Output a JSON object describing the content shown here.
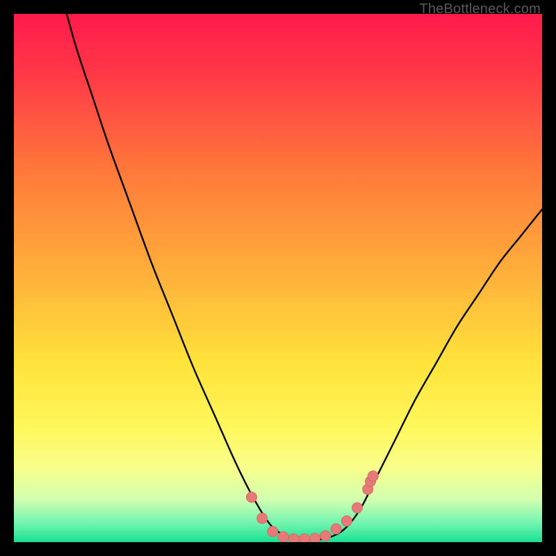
{
  "watermark": "TheBottleneck.com",
  "colors": {
    "frame_bg": "#000000",
    "watermark": "#5a5a5a",
    "curve": "#000000",
    "marker_fill": "#e77a77",
    "marker_stroke": "#d36a67"
  },
  "chart_data": {
    "type": "line",
    "title": "",
    "xlabel": "",
    "ylabel": "",
    "xlim": [
      0,
      100
    ],
    "ylim": [
      0,
      100
    ],
    "gradient_stops": [
      {
        "offset": 0.0,
        "color": "#ff1a4b"
      },
      {
        "offset": 0.12,
        "color": "#ff3a46"
      },
      {
        "offset": 0.3,
        "color": "#ff7a3a"
      },
      {
        "offset": 0.5,
        "color": "#ffb23a"
      },
      {
        "offset": 0.66,
        "color": "#ffe33a"
      },
      {
        "offset": 0.78,
        "color": "#fff75a"
      },
      {
        "offset": 0.86,
        "color": "#f8ff8a"
      },
      {
        "offset": 0.92,
        "color": "#d0ffb0"
      },
      {
        "offset": 0.965,
        "color": "#70f5b0"
      },
      {
        "offset": 1.0,
        "color": "#18e090"
      }
    ],
    "series": [
      {
        "name": "bottleneck-curve",
        "x": [
          10,
          12,
          15,
          18,
          22,
          26,
          30,
          34,
          38,
          42,
          45,
          48,
          50,
          52,
          54,
          56,
          58,
          60,
          62,
          64,
          66,
          68,
          72,
          76,
          80,
          84,
          88,
          92,
          96,
          100
        ],
        "y": [
          100,
          93,
          84,
          75,
          64,
          53,
          43,
          33,
          24,
          15,
          9,
          4,
          2,
          1,
          0.5,
          0.5,
          0.5,
          1,
          2,
          4,
          7,
          11,
          19,
          27,
          34,
          41,
          47,
          53,
          58,
          63
        ]
      }
    ],
    "markers": {
      "name": "highlight-points",
      "x": [
        45,
        47,
        49,
        51,
        53,
        55,
        57,
        59,
        61,
        63,
        65,
        67,
        67.5,
        68
      ],
      "y": [
        8.5,
        4.5,
        2.0,
        1.0,
        0.6,
        0.6,
        0.7,
        1.2,
        2.5,
        4.0,
        6.5,
        10.0,
        11.5,
        12.5
      ]
    }
  }
}
